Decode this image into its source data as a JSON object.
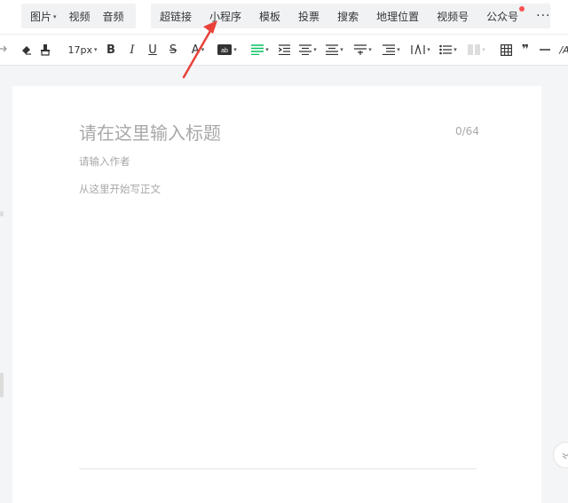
{
  "insert_toolbar": {
    "group1": [
      {
        "label": "图片",
        "has_dropdown": true
      },
      {
        "label": "视频",
        "has_dropdown": false
      },
      {
        "label": "音频",
        "has_dropdown": false
      }
    ],
    "group2": [
      {
        "label": "超链接"
      },
      {
        "label": "小程序"
      },
      {
        "label": "模板"
      },
      {
        "label": "投票"
      },
      {
        "label": "搜索"
      },
      {
        "label": "地理位置"
      },
      {
        "label": "视频号"
      },
      {
        "label": "公众号",
        "has_badge": true
      }
    ],
    "more_label": "···",
    "badge_color": "#fa5151"
  },
  "format_toolbar": {
    "font_size": "17px",
    "bold": "B",
    "italic": "I",
    "underline": "U",
    "strikethrough": "S",
    "font_color": "A",
    "quote": "❞",
    "more_font": "/A",
    "icons": [
      "undo-icon",
      "clear-format-icon",
      "format-brush-icon",
      "bold-icon",
      "italic-icon",
      "underline-icon",
      "strikethrough-icon",
      "font-color-icon",
      "background-color-icon",
      "align-left-icon",
      "indent-icon",
      "align-icon",
      "line-height-icon",
      "paragraph-spacing-icon",
      "first-line-indent-icon",
      "letter-spacing-icon",
      "list-icon",
      "column-icon",
      "table-icon",
      "quote-icon",
      "divider-icon",
      "font-icon"
    ],
    "accent_color": "#07c160"
  },
  "editor": {
    "title_placeholder": "请在这里输入标题",
    "title_counter": "0/64",
    "author_placeholder": "请输入作者",
    "body_placeholder": "从这里开始写正文"
  },
  "annotation": {
    "color": "#e8413a",
    "target": "小程序"
  }
}
